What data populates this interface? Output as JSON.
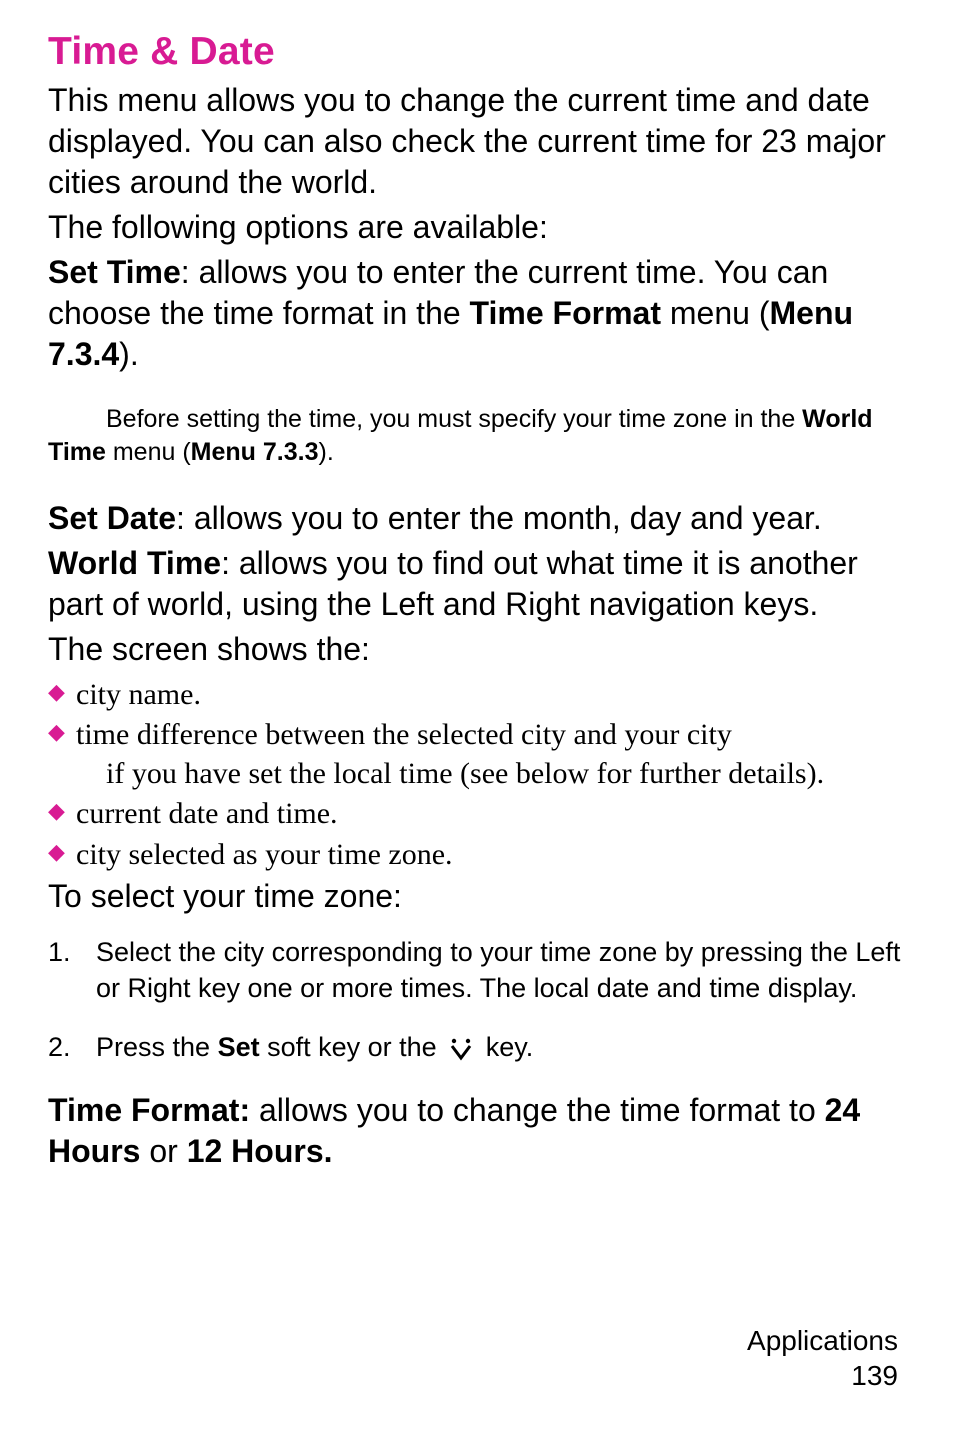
{
  "heading": "Time & Date",
  "intro1": "This menu allows you to change the current time and date displayed. You can also check the current time for 23 major cities around the world.",
  "intro2": "The following options are available:",
  "setTime": {
    "label": "Set Time",
    "text1": ": allows you to enter the current time. You can choose the time format in the ",
    "bold2": "Time Format",
    "text2": " menu (",
    "bold3": "Menu 7.3.4",
    "text3": ")."
  },
  "note": {
    "text1": "Before setting the time, you must specify your time zone in the ",
    "bold1": "World Time",
    "text2": " menu (",
    "bold2": "Menu 7.3.3",
    "text3": ")."
  },
  "setDate": {
    "label": "Set Date",
    "text": ": allows you to enter the month, day and year."
  },
  "worldTime": {
    "label": "World Time",
    "text": ": allows you to find out what time it is another part of world, using the Left and Right navigation keys."
  },
  "screenShows": "The screen shows the:",
  "bullets": {
    "b1": "city name.",
    "b2_first": "time difference between the selected city and your city",
    "b2_rest": "if you have set the local time (see below for further details).",
    "b3": "current date and time.",
    "b4": "city selected as your time zone."
  },
  "toSelect": "To select your time zone:",
  "steps": {
    "s1": "Select the city corresponding to your time zone by pressing the Left or Right key one or more times. The local date and time display.",
    "s2_a": "Press the ",
    "s2_bold": "Set",
    "s2_b": " soft key or the ",
    "s2_c": " key."
  },
  "timeFormat": {
    "label": "Time Format:",
    "text1": " allows you to change the time format to ",
    "bold1": "24 Hours",
    "text2": " or ",
    "bold2": "12 Hours."
  },
  "footer": {
    "section": "Applications",
    "page": "139"
  }
}
